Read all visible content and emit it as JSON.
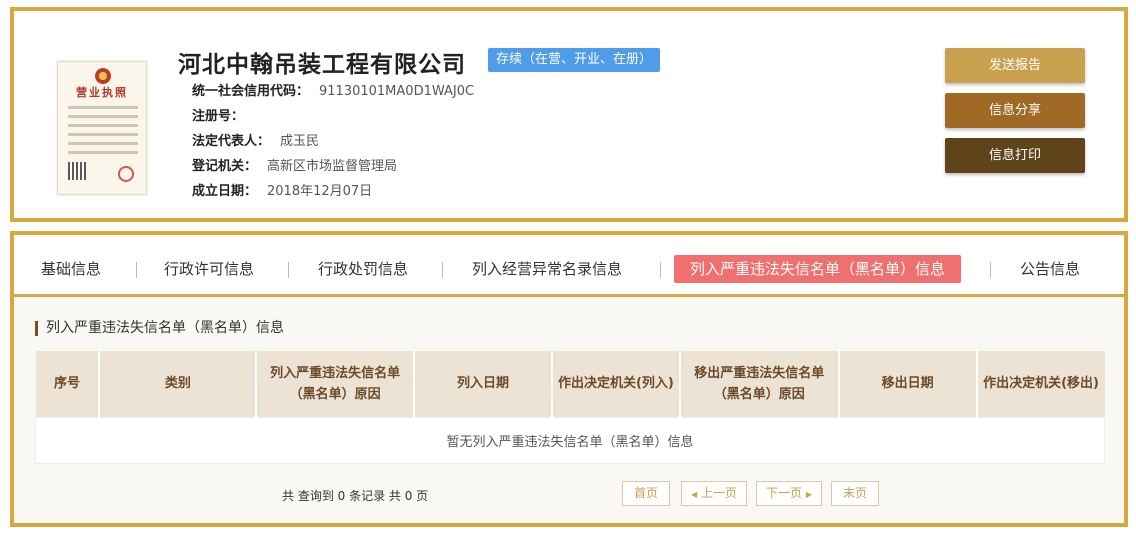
{
  "company": {
    "name": "河北中翰吊装工程有限公司",
    "status": "存续（在营、开业、在册）",
    "license_image": {
      "title": "营业执照"
    },
    "fields": [
      {
        "label": "统一社会信用代码：",
        "value": "91130101MA0D1WAJ0C"
      },
      {
        "label": "注册号：",
        "value": ""
      },
      {
        "label": "法定代表人：",
        "value": "成玉民"
      },
      {
        "label": "登记机关：",
        "value": "高新区市场监督管理局"
      },
      {
        "label": "成立日期：",
        "value": "2018年12月07日"
      }
    ]
  },
  "actions": {
    "send_report": "发送报告",
    "share": "信息分享",
    "print": "信息打印"
  },
  "tabs": [
    {
      "label": "基础信息",
      "active": false
    },
    {
      "label": "行政许可信息",
      "active": false
    },
    {
      "label": "行政处罚信息",
      "active": false
    },
    {
      "label": "列入经营异常名录信息",
      "active": false
    },
    {
      "label": "列入严重违法失信名单（黑名单）信息",
      "active": true
    },
    {
      "label": "公告信息",
      "active": false
    }
  ],
  "section": {
    "title": "列入严重违法失信名单（黑名单）信息"
  },
  "table": {
    "columns": [
      "序号",
      "类别",
      "列入严重违法失信名单（黑名单）原因",
      "列入日期",
      "作出决定机关(列入)",
      "移出严重违法失信名单（黑名单）原因",
      "移出日期",
      "作出决定机关(移出)"
    ],
    "empty_message": "暂无列入严重违法失信名单（黑名单）信息"
  },
  "pagination": {
    "summary": "共 查询到 0 条记录 共 0 页",
    "first": "首页",
    "prev": "上一页",
    "next": "下一页",
    "last": "末页"
  },
  "colors": {
    "accent_border": "#d6a83d",
    "status_badge": "#4f9de8",
    "active_tab": "#f07070",
    "btn_send": "#c9a04e",
    "btn_share": "#a06a26",
    "btn_print": "#5e4418"
  }
}
